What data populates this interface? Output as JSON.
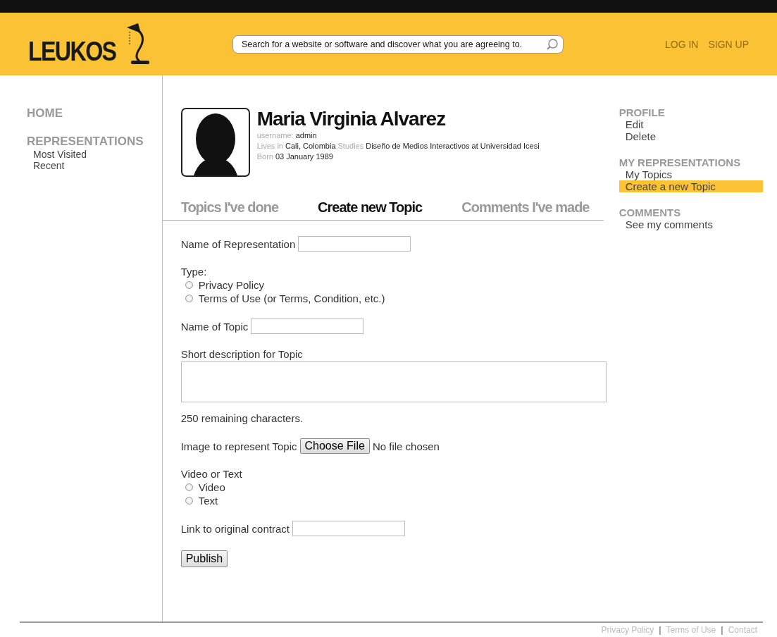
{
  "header": {
    "logo": "LEUKOS",
    "search": {
      "placeholder": "Search for a website or software and discover what you are agreeing to."
    },
    "links": [
      "LOG IN",
      "SIGN UP"
    ]
  },
  "left_nav": [
    {
      "heading": "HOME"
    },
    {
      "heading": "REPRESENTATIONS",
      "items": [
        "Most Visited",
        "Recent"
      ]
    }
  ],
  "profile": {
    "name": "Maria Virginia Alvarez",
    "details": [
      [
        {
          "label": "username:",
          "value": "admin"
        }
      ],
      [
        {
          "label": "Lives in",
          "value": "Cali, Colombia"
        },
        {
          "label": "Studies",
          "value": "Diseño de Medios Interactivos at Universidad Icesi"
        }
      ],
      [
        {
          "label": "Born",
          "value": "03 January 1989"
        }
      ]
    ]
  },
  "tabs": [
    {
      "label": "Topics I've done",
      "selected": false
    },
    {
      "label": "Create new Topic",
      "selected": true
    },
    {
      "label": "Comments I've made",
      "selected": false
    }
  ],
  "form": [
    {
      "kind": "text",
      "label": "Name of Representation"
    },
    {
      "kind": "radio",
      "label": "Type:",
      "options": [
        {
          "label": "Privacy Policy",
          "selected": false
        },
        {
          "label": "Terms of Use (or Terms, Condition, etc.)",
          "selected": false
        }
      ]
    },
    {
      "kind": "text",
      "label": "Name of Topic"
    },
    {
      "kind": "textarea",
      "label": "Short description for Topic"
    },
    {
      "kind": "note",
      "label": "250 remaining characters."
    },
    {
      "kind": "file",
      "label": "Image to represent Topic",
      "button": "Choose File",
      "status": "No file chosen"
    },
    {
      "kind": "radio",
      "label": "Video or Text",
      "options": [
        {
          "label": "Video",
          "selected": false
        },
        {
          "label": "Text",
          "selected": false
        }
      ]
    },
    {
      "kind": "text",
      "label": "Link to original contract"
    },
    {
      "kind": "submit",
      "label": "Publish"
    }
  ],
  "right_nav": [
    {
      "heading": "PROFILE",
      "items": [
        {
          "label": "Edit",
          "selected": false
        },
        {
          "label": "Delete",
          "selected": false
        }
      ]
    },
    {
      "heading": "MY REPRESENTATIONS",
      "items": [
        {
          "label": "My Topics",
          "selected": false
        },
        {
          "label": "Create a new Topic",
          "selected": true
        }
      ]
    },
    {
      "heading": "COMMENTS",
      "items": [
        {
          "label": "See my comments",
          "selected": false
        }
      ]
    }
  ],
  "footer": [
    {
      "kind": "link",
      "label": "Privacy Policy"
    },
    {
      "kind": "separator",
      "label": "|"
    },
    {
      "kind": "link",
      "label": "Terms of Use"
    },
    {
      "kind": "separator",
      "label": "|"
    },
    {
      "kind": "link",
      "label": "Contact"
    }
  ]
}
